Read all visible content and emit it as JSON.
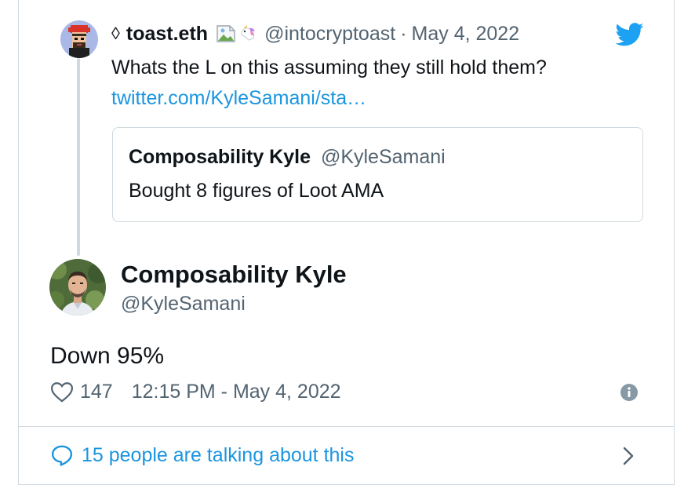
{
  "parent_tweet": {
    "eth_symbol": "◊",
    "display_name": "toast.eth",
    "emoji_icons": [
      "broken-image-icon",
      "unicorn-icon"
    ],
    "handle": "@intocryptoast",
    "separator": "·",
    "date": "May 4, 2022",
    "text": "Whats the L on this assuming they still hold them?",
    "link": "twitter.com/KyleSamani/sta…",
    "quoted": {
      "display_name": "Composability Kyle",
      "handle": "@KyleSamani",
      "text": "Bought 8 figures of Loot AMA"
    }
  },
  "main_tweet": {
    "display_name": "Composability Kyle",
    "handle": "@KyleSamani",
    "text": "Down 95%",
    "likes": "147",
    "timestamp": "12:15 PM - May 4, 2022"
  },
  "footer": {
    "label": "15 people are talking about this"
  },
  "colors": {
    "twitter_blue": "#1da1f2",
    "link_blue": "#1b95e0",
    "secondary_text": "#536471",
    "border": "#cfd9de"
  }
}
